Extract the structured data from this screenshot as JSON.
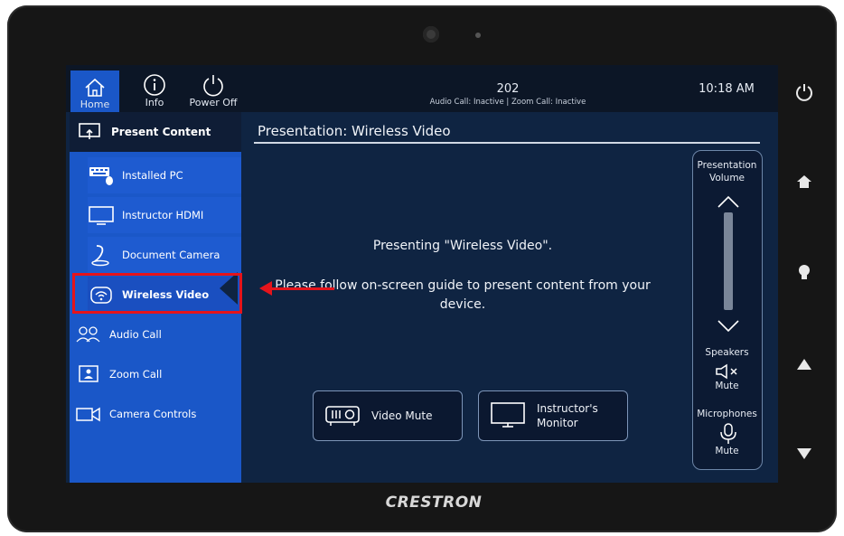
{
  "device": {
    "brand": "CRESTRON",
    "hardware_buttons": [
      {
        "name": "power",
        "glyph": "⏻"
      },
      {
        "name": "home",
        "glyph": "⌂"
      },
      {
        "name": "light",
        "glyph": "💡"
      },
      {
        "name": "up",
        "glyph": "▲"
      },
      {
        "name": "down",
        "glyph": "▼"
      }
    ]
  },
  "topbar": {
    "home_label": "Home",
    "info_label": "Info",
    "power_label": "Power Off",
    "room_number": "202",
    "call_status": "Audio Call: Inactive | Zoom Call: Inactive",
    "time": "10:18 AM"
  },
  "sidebar": {
    "header": "Present Content",
    "sub_items": [
      {
        "label": "Installed PC",
        "icon": "keyboard-pc-icon"
      },
      {
        "label": "Instructor HDMI",
        "icon": "monitor-icon"
      },
      {
        "label": "Document Camera",
        "icon": "document-camera-icon"
      },
      {
        "label": "Wireless Video",
        "icon": "wireless-video-icon",
        "selected": true
      }
    ],
    "items": [
      {
        "label": "Audio Call",
        "icon": "audio-call-icon"
      },
      {
        "label": "Zoom Call",
        "icon": "zoom-call-icon"
      },
      {
        "label": "Camera Controls",
        "icon": "camera-icon"
      }
    ]
  },
  "main": {
    "title": "Presentation: Wireless Video",
    "message_line1": "Presenting \"Wireless Video\".",
    "message_line2": "Please follow on-screen guide to present content from your device.",
    "video_mute_label": "Video Mute",
    "instructor_monitor_label": "Instructor's Monitor"
  },
  "volume": {
    "title": "Presentation Volume",
    "speakers_label": "Speakers",
    "speakers_mute_label": "Mute",
    "microphones_label": "Microphones",
    "microphones_mute_label": "Mute"
  },
  "colors": {
    "sidebar_blue": "#1a57c8",
    "screen_bg": "#0f2442",
    "highlight_red": "#e5141b"
  }
}
